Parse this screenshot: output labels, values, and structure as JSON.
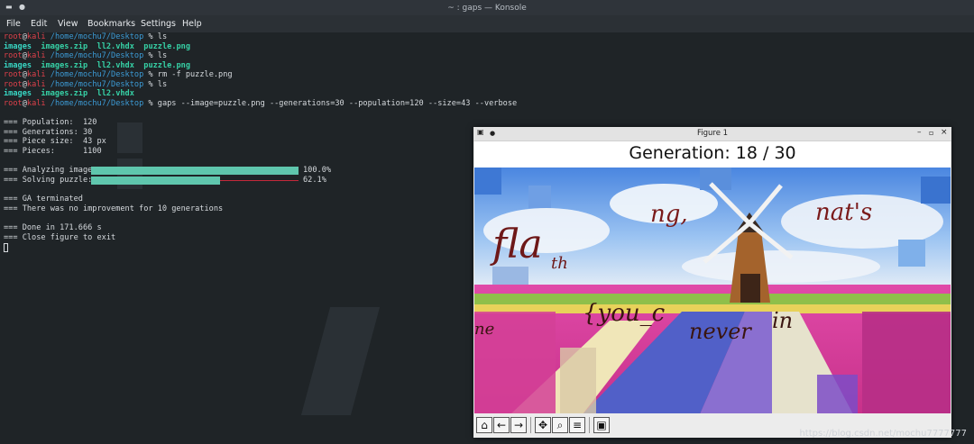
{
  "window": {
    "title": "~ : gaps — Konsole"
  },
  "menu": [
    "File",
    "Edit",
    "View",
    "Bookmarks",
    "Settings",
    "Help"
  ],
  "prompt": {
    "user": "root",
    "at": "@",
    "host": "kali",
    "path": " /home/mochu7/Desktop",
    "symbol": " % "
  },
  "commands": {
    "c1": "ls",
    "c2": "ls",
    "c3": "rm -f puzzle.png",
    "c4": "ls",
    "c5": "gaps --image=puzzle.png --generations=30 --population=120 --size=43 --verbose"
  },
  "ls_outputs": {
    "o1": [
      "images",
      "images.zip",
      "ll2.vhdx",
      "puzzle.png"
    ],
    "o2": [
      "images",
      "images.zip",
      "ll2.vhdx",
      "puzzle.png"
    ],
    "o3": [
      "images",
      "images.zip",
      "ll2.vhdx"
    ]
  },
  "stats": {
    "population": "=== Population:  120",
    "generations": "=== Generations: 30",
    "piece_size": "=== Piece size:  43 px",
    "pieces": "=== Pieces:      1100"
  },
  "progress": {
    "analyzing_label": "=== Analyzing image:",
    "analyzing_value": "100.0%",
    "analyzing_fraction": 1.0,
    "solving_label": "=== Solving puzzle:",
    "solving_value": "62.1%",
    "solving_fraction": 0.621
  },
  "messages": {
    "ga_terminated": "=== GA terminated",
    "no_improvement": "=== There was no improvement for 10 generations",
    "done": "=== Done in 171.666 s",
    "close": "=== Close figure to exit"
  },
  "figure": {
    "window_title": "Figure 1",
    "plot_title": "Generation: 18 / 30",
    "image_words": [
      "ng,",
      "nat's",
      "fla",
      "th",
      "{you_c",
      "never",
      "in",
      "ne"
    ]
  },
  "toolbar_icons": [
    "home-icon",
    "back-icon",
    "forward-icon",
    "pan-icon",
    "zoom-icon",
    "configure-icon",
    "save-icon"
  ],
  "watermark": "https://blog.csdn.net/mochu7777777",
  "colors": {
    "prompt_red": "#e0414b",
    "path_blue": "#3c9bd6",
    "dir_cyan": "#38d6c3",
    "progress_fill": "#5fc6ad",
    "progress_rest": "#c4283a"
  }
}
